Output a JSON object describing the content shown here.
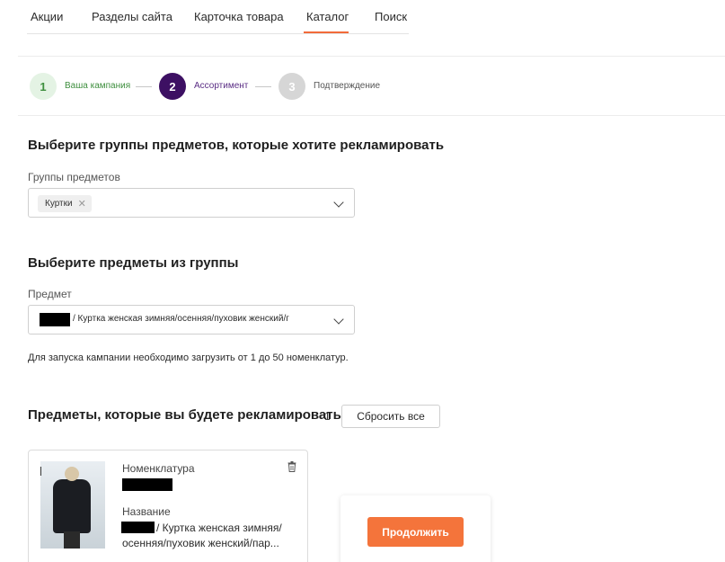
{
  "tabs": [
    {
      "label": "Акции",
      "active": false
    },
    {
      "label": "Разделы сайта",
      "active": false
    },
    {
      "label": "Карточка товара",
      "active": false
    },
    {
      "label": "Каталог",
      "active": true
    },
    {
      "label": "Поиск",
      "active": false
    }
  ],
  "stepper": {
    "steps": [
      {
        "number": "1",
        "label": "Ваша кампания",
        "state": "done"
      },
      {
        "number": "2",
        "label": "Ассортимент",
        "state": "current"
      },
      {
        "number": "3",
        "label": "Подтверждение",
        "state": "pending"
      }
    ]
  },
  "groups_section": {
    "title": "Выберите группы предметов, которые хотите рекламировать",
    "field_label": "Группы предметов",
    "chip": "Куртки"
  },
  "items_section": {
    "title": "Выберите предметы из группы",
    "field_label": "Предмет",
    "selected_text": "/ Куртка женская зимняя/осенняя/пуховик женский/г",
    "hint": "Для запуска кампании необходимо загрузить от 1 до 50 номенклатур."
  },
  "selected_section": {
    "title": "Предметы, которые вы будете рекламировать",
    "count": "1",
    "reset_label": "Сбросить все"
  },
  "product_card": {
    "nomenclature_label": "Номенклатура",
    "name_label": "Название",
    "name_text": "/ Куртка женская зимняя/ осенняя/пуховик женский/пар..."
  },
  "continue_label": "Продолжить",
  "colors": {
    "accent": "#f4743b",
    "step_done_bg": "#e4f3e4",
    "step_done_text": "#3f8f3f",
    "step_current_bg": "#3d1063",
    "step_pending_bg": "#d6d6d6"
  }
}
